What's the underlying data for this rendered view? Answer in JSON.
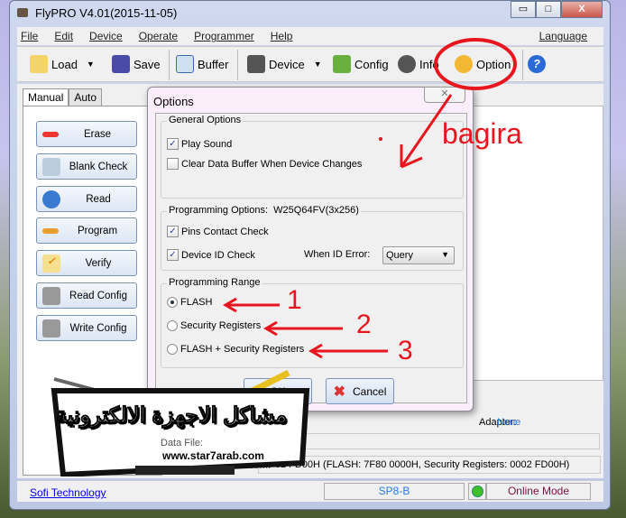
{
  "window": {
    "title": "FlyPRO V4.01(2015-11-05)",
    "minimize": "▭",
    "maximize": "□",
    "close": "X"
  },
  "menu": {
    "items": [
      "File",
      "Edit",
      "Device",
      "Operate",
      "Programmer",
      "Help"
    ],
    "language": "Language"
  },
  "toolbar": {
    "load": "Load",
    "save": "Save",
    "buffer": "Buffer",
    "device": "Device",
    "config": "Config",
    "info": "Info",
    "option": "Option"
  },
  "left": {
    "tabs": [
      "Manual",
      "Auto"
    ],
    "buttons": [
      "Erase",
      "Blank Check",
      "Read",
      "Program",
      "Verify",
      "Read Config",
      "Write Config"
    ]
  },
  "right": {
    "adapter_label": "Adapter:",
    "adapter_value": "None",
    "data_file_label": "Data File:",
    "checksum_label": "Checksum:",
    "checksum_value": "7F82 FD00H (FLASH: 7F80 0000H, Security Registers: 0002 FD00H)"
  },
  "dialog": {
    "title": "Options",
    "general": {
      "label": "General Options",
      "play_sound": "Play Sound",
      "play_sound_checked": true,
      "clear_buffer": "Clear Data Buffer When Device Changes",
      "clear_buffer_checked": false
    },
    "programming": {
      "label": "Programming Options:",
      "device": "W25Q64FV(3x256)",
      "pins_check": "Pins Contact Check",
      "pins_check_checked": true,
      "id_check": "Device ID Check",
      "id_check_checked": true,
      "id_error_label": "When ID Error:",
      "id_error_value": "Query"
    },
    "range": {
      "label": "Programming Range",
      "options": [
        "FLASH",
        "Security Registers",
        "FLASH + Security Registers"
      ],
      "selected": "FLASH"
    },
    "ok": "OK",
    "cancel": "Cancel"
  },
  "status": {
    "company": "Sofi Technology",
    "programmer": "SP8-B",
    "mode": "Online Mode",
    "led_color": "#3fbf2a"
  },
  "annotations": {
    "author": "bagira",
    "numbers": [
      "1",
      "2",
      "3"
    ],
    "color": "#e8141e"
  },
  "watermark": {
    "arabic": "مشاكل الاجهزة الالكترونية",
    "url": "www.star7arab.com"
  }
}
